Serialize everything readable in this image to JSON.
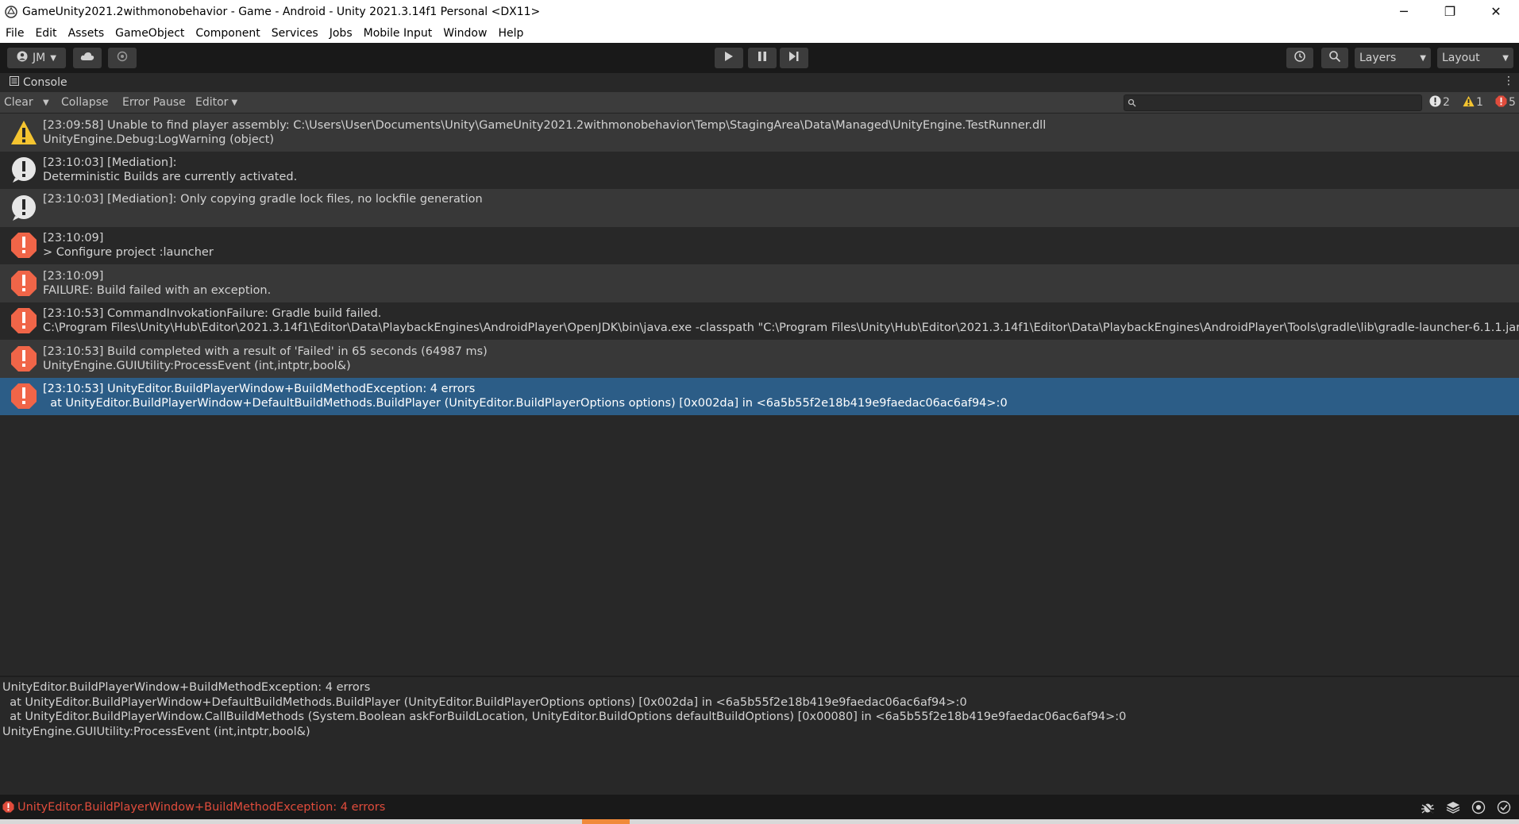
{
  "window": {
    "title": "GameUnity2021.2withmonobehavior - Game - Android - Unity 2021.3.14f1 Personal <DX11>",
    "minimize": "─",
    "restore": "❐",
    "close": "✕"
  },
  "menu": [
    "File",
    "Edit",
    "Assets",
    "GameObject",
    "Component",
    "Services",
    "Jobs",
    "Mobile Input",
    "Window",
    "Help"
  ],
  "toolbar": {
    "account_label": "JM",
    "layers_label": "Layers",
    "layout_label": "Layout"
  },
  "console": {
    "tab_label": "Console",
    "clear_label": "Clear",
    "collapse_label": "Collapse",
    "error_pause_label": "Error Pause",
    "editor_label": "Editor",
    "info_count": "2",
    "warning_count": "1",
    "error_count": "5"
  },
  "logs": [
    {
      "type": "warning",
      "line1": "[23:09:58] Unable to find player assembly: C:\\Users\\User\\Documents\\Unity\\GameUnity2021.2withmonobehavior\\Temp\\StagingArea\\Data\\Managed\\UnityEngine.TestRunner.dll",
      "line2": "UnityEngine.Debug:LogWarning (object)"
    },
    {
      "type": "info",
      "line1": "[23:10:03] [Mediation]:",
      "line2": "Deterministic Builds are currently activated."
    },
    {
      "type": "info",
      "line1": "[23:10:03] [Mediation]: Only copying gradle lock files, no lockfile generation",
      "line2": ""
    },
    {
      "type": "error",
      "line1": "[23:10:09]",
      "line2": "> Configure project :launcher"
    },
    {
      "type": "error",
      "line1": "[23:10:09]",
      "line2": "FAILURE: Build failed with an exception."
    },
    {
      "type": "error",
      "line1": "[23:10:53] CommandInvokationFailure: Gradle build failed.",
      "line2": "C:\\Program Files\\Unity\\Hub\\Editor\\2021.3.14f1\\Editor\\Data\\PlaybackEngines\\AndroidPlayer\\OpenJDK\\bin\\java.exe -classpath \"C:\\Program Files\\Unity\\Hub\\Editor\\2021.3.14f1\\Editor\\Data\\PlaybackEngines\\AndroidPlayer\\Tools\\gradle\\lib\\gradle-launcher-6.1.1.jar"
    },
    {
      "type": "error",
      "line1": "[23:10:53] Build completed with a result of 'Failed' in 65 seconds (64987 ms)",
      "line2": "UnityEngine.GUIUtility:ProcessEvent (int,intptr,bool&)"
    },
    {
      "type": "error",
      "line1": "[23:10:53] UnityEditor.BuildPlayerWindow+BuildMethodException: 4 errors",
      "line2": "  at UnityEditor.BuildPlayerWindow+DefaultBuildMethods.BuildPlayer (UnityEditor.BuildPlayerOptions options) [0x002da] in <6a5b55f2e18b419e9faedac06ac6af94>:0",
      "selected": true
    }
  ],
  "detail": {
    "text": "UnityEditor.BuildPlayerWindow+BuildMethodException: 4 errors\n  at UnityEditor.BuildPlayerWindow+DefaultBuildMethods.BuildPlayer (UnityEditor.BuildPlayerOptions options) [0x002da] in <6a5b55f2e18b419e9faedac06ac6af94>:0\n  at UnityEditor.BuildPlayerWindow.CallBuildMethods (System.Boolean askForBuildLocation, UnityEditor.BuildOptions defaultBuildOptions) [0x00080] in <6a5b55f2e18b419e9faedac06ac6af94>:0\nUnityEngine.GUIUtility:ProcessEvent (int,intptr,bool&)"
  },
  "status": {
    "message": "UnityEditor.BuildPlayerWindow+BuildMethodException: 4 errors"
  },
  "colors": {
    "error": "#e04c3c",
    "warning": "#f4c430",
    "selected": "#2c5d87"
  }
}
